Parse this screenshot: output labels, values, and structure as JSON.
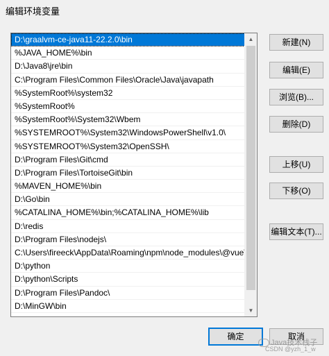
{
  "window": {
    "title": "编辑环境变量"
  },
  "path_list": {
    "items": [
      "D:\\graalvm-ce-java11-22.2.0\\bin",
      "%JAVA_HOME%\\bin",
      "D:\\Java8\\jre\\bin",
      "C:\\Program Files\\Common Files\\Oracle\\Java\\javapath",
      "%SystemRoot%\\system32",
      "%SystemRoot%",
      "%SystemRoot%\\System32\\Wbem",
      "%SYSTEMROOT%\\System32\\WindowsPowerShell\\v1.0\\",
      "%SYSTEMROOT%\\System32\\OpenSSH\\",
      "D:\\Program Files\\Git\\cmd",
      "D:\\Program Files\\TortoiseGit\\bin",
      "%MAVEN_HOME%\\bin",
      "D:\\Go\\bin",
      "%CATALINA_HOME%\\bin;%CATALINA_HOME%\\lib",
      "D:\\redis",
      "D:\\Program Files\\nodejs\\",
      "C:\\Users\\fireeck\\AppData\\Roaming\\npm\\node_modules\\@vue\\cli",
      "D:\\python",
      "D:\\python\\Scripts",
      "D:\\Program Files\\Pandoc\\",
      "D:\\MinGW\\bin"
    ],
    "selected_index": 0
  },
  "buttons": {
    "new": "新建(N)",
    "edit": "编辑(E)",
    "browse": "浏览(B)...",
    "delete": "删除(D)",
    "move_up": "上移(U)",
    "move_down": "下移(O)",
    "edit_text": "编辑文本(T)...",
    "ok": "确定",
    "cancel": "取消"
  },
  "watermark": {
    "text": "Java技术栈子",
    "sub": "CSDN @yzh_1_w"
  },
  "icons": {
    "scroll_up": "scroll-up-arrow-icon",
    "scroll_down": "scroll-down-arrow-icon",
    "watermark": "wechat-icon"
  },
  "colors": {
    "selection": "#0078d7",
    "default_button_border": "#0078d7"
  }
}
